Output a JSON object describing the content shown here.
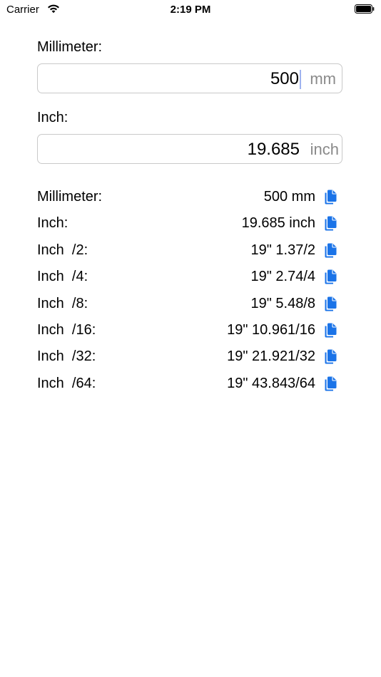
{
  "status_bar": {
    "carrier": "Carrier",
    "time": "2:19 PM"
  },
  "millimeter_input": {
    "label": "Millimeter:",
    "value": "500",
    "unit": "mm"
  },
  "inch_input": {
    "label": "Inch:",
    "value": "19.685",
    "unit": "inch"
  },
  "results": [
    {
      "label": "Millimeter:",
      "value": "500 mm"
    },
    {
      "label": "Inch:",
      "value": "19.685 inch"
    },
    {
      "label": "Inch  /2:",
      "value": "19\" 1.37/2"
    },
    {
      "label": "Inch  /4:",
      "value": "19\" 2.74/4"
    },
    {
      "label": "Inch  /8:",
      "value": "19\" 5.48/8"
    },
    {
      "label": "Inch  /16:",
      "value": "19\" 10.961/16"
    },
    {
      "label": "Inch  /32:",
      "value": "19\" 21.921/32"
    },
    {
      "label": "Inch  /64:",
      "value": "19\" 43.843/64"
    }
  ],
  "icons": {
    "copy": "copy-icon",
    "wifi": "wifi-icon",
    "battery": "battery-icon"
  },
  "colors": {
    "accent": "#1a73e8",
    "placeholder_unit": "#8a8a8a",
    "caret": "#9fb3f0"
  }
}
